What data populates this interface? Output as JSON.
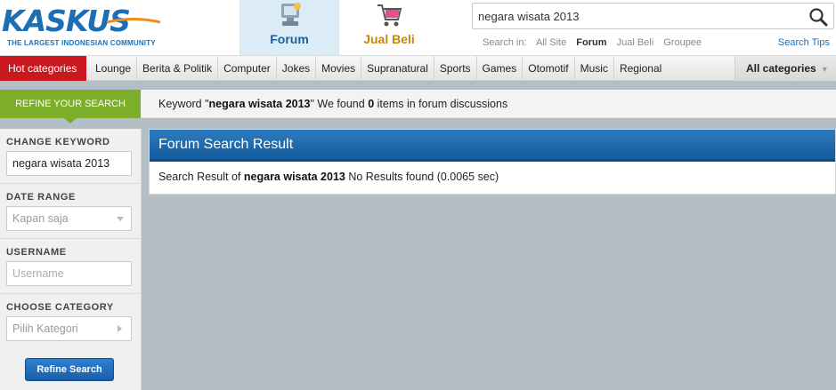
{
  "logo": {
    "word": "KASKUS",
    "tagline": "THE LARGEST INDONESIAN COMMUNITY"
  },
  "tabs": [
    {
      "label": "Forum",
      "icon": "forum-icon"
    },
    {
      "label": "Jual Beli",
      "icon": "shopping-cart-icon"
    }
  ],
  "search": {
    "value": "negara wisata 2013",
    "search_in_label": "Search in:",
    "scopes": [
      "All Site",
      "Forum",
      "Jual Beli",
      "Groupee"
    ],
    "active_scope": "Forum",
    "tips": "Search Tips"
  },
  "nav": {
    "hot": "Hot categories",
    "items": [
      "Lounge",
      "Berita & Politik",
      "Computer",
      "Jokes",
      "Movies",
      "Supranatural",
      "Sports",
      "Games",
      "Otomotif",
      "Music",
      "Regional"
    ],
    "all": "All categories"
  },
  "refine": {
    "tab_label": "REFINE YOUR SEARCH",
    "keyword_prefix": "Keyword \"",
    "keyword": "negara wisata 2013",
    "keyword_mid": "\" We found ",
    "count": "0",
    "keyword_suffix": " items in forum discussions"
  },
  "sidebar": {
    "change_keyword_label": "CHANGE KEYWORD",
    "keyword_value": "negara wisata 2013",
    "date_range_label": "DATE RANGE",
    "date_range_value": "Kapan saja",
    "username_label": "USERNAME",
    "username_placeholder": "Username",
    "category_label": "CHOOSE CATEGORY",
    "category_value": "Pilih Kategori",
    "button": "Refine Search"
  },
  "results": {
    "title": "Forum Search Result",
    "prefix": "Search Result of ",
    "keyword": "negara wisata 2013",
    "suffix": " No Results found (0.0065 sec)"
  },
  "colors": {
    "brand_blue": "#1c6fb5",
    "hot_red": "#c9181e",
    "refine_green": "#7cae2a",
    "jualbeli_orange": "#c8860c",
    "result_header_blue": "#1d6aae"
  }
}
